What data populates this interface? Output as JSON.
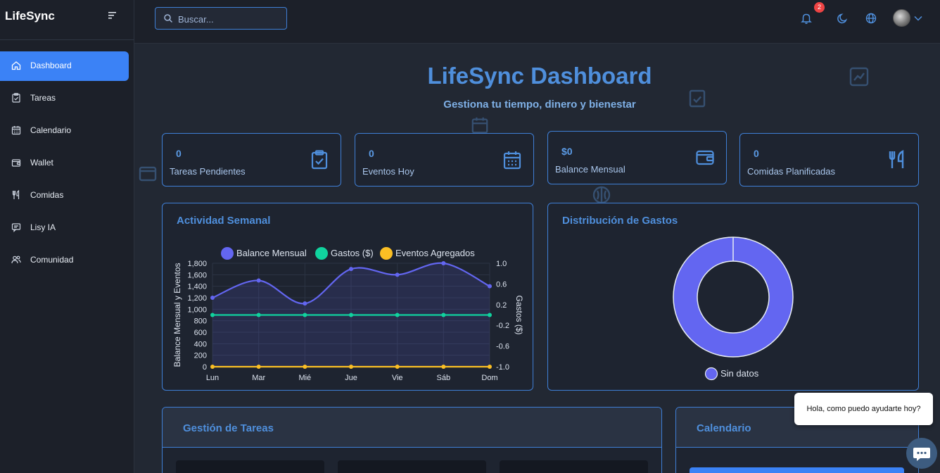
{
  "app": {
    "name": "LifeSync"
  },
  "sidebar": {
    "items": [
      {
        "label": "Dashboard",
        "icon": "home-icon",
        "active": true
      },
      {
        "label": "Tareas",
        "icon": "clipboard-check-icon"
      },
      {
        "label": "Calendario",
        "icon": "calendar-icon"
      },
      {
        "label": "Wallet",
        "icon": "wallet-icon"
      },
      {
        "label": "Comidas",
        "icon": "utensils-icon"
      },
      {
        "label": "Lisy IA",
        "icon": "chat-icon"
      },
      {
        "label": "Comunidad",
        "icon": "users-icon"
      }
    ]
  },
  "topbar": {
    "search_placeholder": "Buscar...",
    "notification_count": "2"
  },
  "header": {
    "title": "LifeSync Dashboard",
    "subtitle": "Gestiona tu tiempo, dinero y bienestar"
  },
  "stats": [
    {
      "value": "0",
      "label": "Tareas Pendientes",
      "icon": "clipboard-check-icon"
    },
    {
      "value": "0",
      "label": "Eventos Hoy",
      "icon": "calendar-icon"
    },
    {
      "value": "$0",
      "label": "Balance Mensual",
      "icon": "wallet-icon"
    },
    {
      "value": "0",
      "label": "Comidas Planificadas",
      "icon": "utensils-icon"
    }
  ],
  "activity": {
    "title": "Actividad Semanal"
  },
  "expenses": {
    "title": "Distribución de Gastos"
  },
  "tasks": {
    "title": "Gestión de Tareas"
  },
  "calendar": {
    "title": "Calendario"
  },
  "chat": {
    "greeting": "Hola, como puedo ayudarte hoy?"
  },
  "colors": {
    "accent": "#3b82f6",
    "balance": "#6366f1",
    "gastos": "#10d39e",
    "eventos": "#fbbf24",
    "badge": "#ef4444"
  },
  "chart_data": [
    {
      "type": "line",
      "title": "",
      "categories": [
        "Lun",
        "Mar",
        "Mié",
        "Jue",
        "Vie",
        "Sáb",
        "Dom"
      ],
      "series": [
        {
          "name": "Balance Mensual",
          "axis": "left",
          "values": [
            1200,
            1500,
            1100,
            1700,
            1600,
            1800,
            1400
          ]
        },
        {
          "name": "Gastos ($)",
          "axis": "right",
          "values": [
            0,
            0,
            0,
            0,
            0,
            0,
            0
          ]
        },
        {
          "name": "Eventos Agregados",
          "axis": "left",
          "values": [
            0,
            0,
            0,
            0,
            0,
            0,
            0
          ]
        }
      ],
      "ylabel": "Balance Mensual y Eventos",
      "y2label": "Gastos ($)",
      "ylim": [
        0,
        1800
      ],
      "yticks": [
        "0",
        "200",
        "400",
        "600",
        "800",
        "1,000",
        "1,200",
        "1,400",
        "1,600",
        "1,800"
      ],
      "y2lim": [
        -1.0,
        1.0
      ],
      "y2ticks": [
        "-1.0",
        "-0.6",
        "-0.2",
        "0.2",
        "0.6",
        "1.0"
      ],
      "legend": "top"
    },
    {
      "type": "pie",
      "title": "",
      "labels": [
        "Sin datos"
      ],
      "values": [
        1
      ],
      "donut": true,
      "legend": "bottom"
    }
  ]
}
